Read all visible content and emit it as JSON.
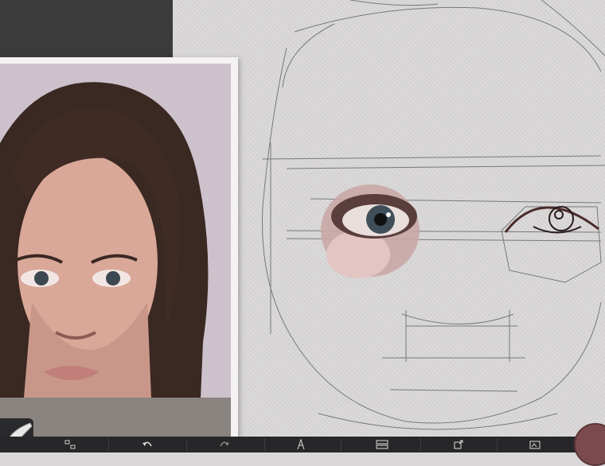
{
  "app": {
    "toolbar": {
      "items": [
        {
          "icon": "transform-icon"
        },
        {
          "icon": "undo-icon"
        },
        {
          "icon": "redo-icon"
        },
        {
          "icon": "brush-settings-icon"
        },
        {
          "icon": "layers-icon"
        },
        {
          "icon": "export-icon"
        },
        {
          "icon": "gallery-icon"
        }
      ]
    },
    "current_color": "#7a4a4e",
    "brush_tool": {
      "icon": "pencil-brush-icon"
    }
  }
}
